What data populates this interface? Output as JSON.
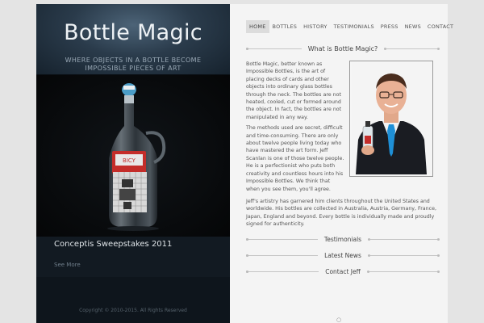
{
  "site": {
    "title": "Bottle Magic",
    "tagline": "Where objects in a bottle become impossible pieces of art"
  },
  "slide": {
    "title": "Conceptis Sweepstakes 2011",
    "see_more": "See More"
  },
  "footer": {
    "copyright": "Copyright © 2010-2015. All Rights Reserved"
  },
  "nav": {
    "items": [
      {
        "label": "HOME",
        "active": true
      },
      {
        "label": "BOTTLES"
      },
      {
        "label": "HISTORY"
      },
      {
        "label": "TESTIMONIALS"
      },
      {
        "label": "PRESS"
      },
      {
        "label": "NEWS"
      },
      {
        "label": "CONTACT"
      }
    ]
  },
  "main": {
    "section_title": "What is Bottle Magic?",
    "paragraph1": "Bottle Magic, better known as Impossible Bottles, is the art of placing decks of cards and other objects into ordinary glass bottles through the neck. The bottles are not heated, cooled, cut or formed around the object. In fact, the bottles are not manipulated in any way.",
    "paragraph2": "The methods used are secret, difficult and time-consuming. There are only about twelve people living today who have mastered the art form. Jeff Scanlan is one of those twelve people. He is a perfectionist who puts both creativity and countless hours into his Impossible Bottles. We think that when you see them, you'll agree.",
    "paragraph3": "Jeff's artistry has garnered him clients throughout the United States and worldwide. His bottles are collected in Australia, Austria, Germany, France, Japan, England and beyond. Every bottle is individually made and proudly signed for authenticity."
  },
  "sections": {
    "testimonials": "Testimonials",
    "latest_news": "Latest News",
    "contact": "Contact Jeff"
  },
  "colors": {
    "accent_tie": "#1e8fd6",
    "left_panel": "#0c1218",
    "right_panel": "#f4f4f4"
  }
}
